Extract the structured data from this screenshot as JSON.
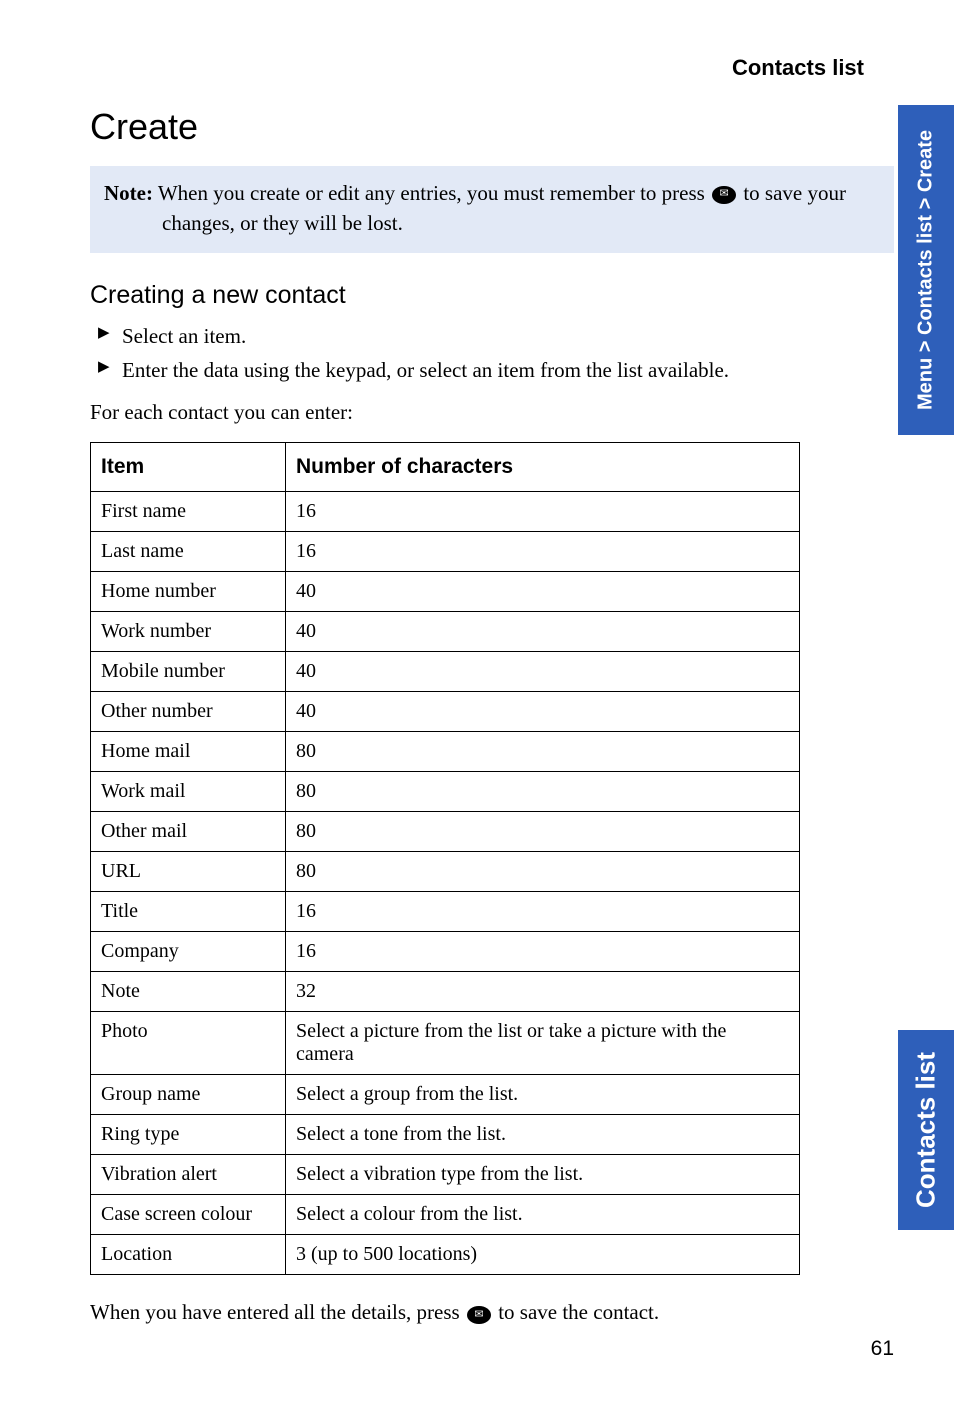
{
  "header": {
    "section": "Contacts list"
  },
  "title": "Create",
  "note": {
    "label": "Note:",
    "line1_before_icon": "When you create or edit any entries, you must remember to press ",
    "line1_after_icon": " to save your",
    "line2": "changes, or they will be lost."
  },
  "subheading": "Creating a new contact",
  "bullets": [
    "Select an item.",
    "Enter the data using the keypad, or select an item from the list available."
  ],
  "intro_after_bullets": "For each contact you can enter:",
  "table": {
    "head": {
      "col0": "Item",
      "col1": "Number of characters"
    },
    "rows": [
      {
        "item": "First name",
        "value": "16"
      },
      {
        "item": "Last name",
        "value": "16"
      },
      {
        "item": "Home number",
        "value": "40"
      },
      {
        "item": "Work number",
        "value": "40"
      },
      {
        "item": "Mobile number",
        "value": "40"
      },
      {
        "item": "Other number",
        "value": "40"
      },
      {
        "item": "Home mail",
        "value": "80"
      },
      {
        "item": "Work mail",
        "value": "80"
      },
      {
        "item": "Other mail",
        "value": "80"
      },
      {
        "item": "URL",
        "value": "80"
      },
      {
        "item": "Title",
        "value": "16"
      },
      {
        "item": "Company",
        "value": "16"
      },
      {
        "item": "Note",
        "value": "32"
      },
      {
        "item": "Photo",
        "value": "Select a picture from the list or take a picture with the camera"
      },
      {
        "item": "Group name",
        "value": "Select a group from the list."
      },
      {
        "item": "Ring type",
        "value": "Select a tone from the list."
      },
      {
        "item": "Vibration alert",
        "value": "Select a vibration type from the list."
      },
      {
        "item": "Case screen colour",
        "value": "Select a colour from the list."
      },
      {
        "item": "Location",
        "value": "3 (up to 500 locations)"
      }
    ]
  },
  "footer": {
    "before_icon": "When you have entered all the details, press ",
    "after_icon": " to save the contact."
  },
  "side": {
    "breadcrumb": "Menu > Contacts list > Create",
    "section": "Contacts list"
  },
  "page_number": "61"
}
